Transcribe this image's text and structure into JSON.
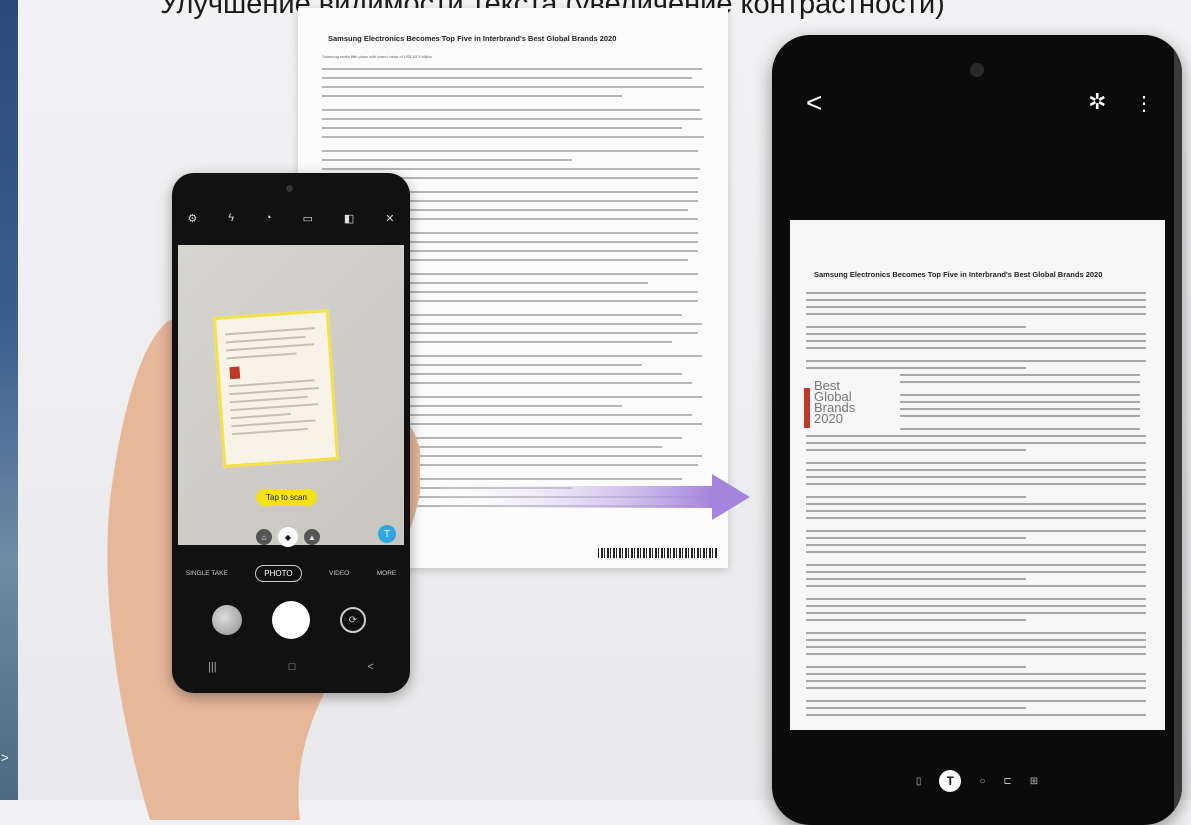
{
  "title": "Улучшение видимости текста (увеличение контрастности)",
  "side_strip": {
    "arrow": ">"
  },
  "paper": {
    "headline": "Samsung Electronics Becomes Top Five in Interbrand's Best Global Brands 2020",
    "subline": "Samsung ranks fifth place with brand value of US$ 62.3 billion"
  },
  "left_phone": {
    "top_icons": [
      "settings-icon",
      "flash-icon",
      "timer-icon",
      "ratio-icon",
      "motion-icon",
      "filter-icon"
    ],
    "tap_to_scan": "Tap to scan",
    "lens_options": [
      "⌂",
      "◆",
      "▲"
    ],
    "scan_button_glyph": "T",
    "modes": [
      "SINGLE TAKE",
      "PHOTO",
      "VIDEO",
      "MORE"
    ],
    "active_mode": "PHOTO",
    "nav": [
      "|||",
      "□",
      "<"
    ]
  },
  "right_phone": {
    "back_glyph": "<",
    "star_glyph": "✲",
    "more_glyph": "⋮",
    "doc_headline": "Samsung Electronics Becomes Top Five in Interbrand's Best Global Brands 2020",
    "badge_text": "Best\nGlobal\nBrands\n2020",
    "bottom_glyph": "T",
    "bottom_icons": [
      "▯",
      "○",
      "⊏",
      "⊞"
    ]
  },
  "colors": {
    "arrow": "#b49ae0",
    "tap_to_scan_bg": "#f5e216",
    "scan_button_bg": "#2fa6e3"
  }
}
